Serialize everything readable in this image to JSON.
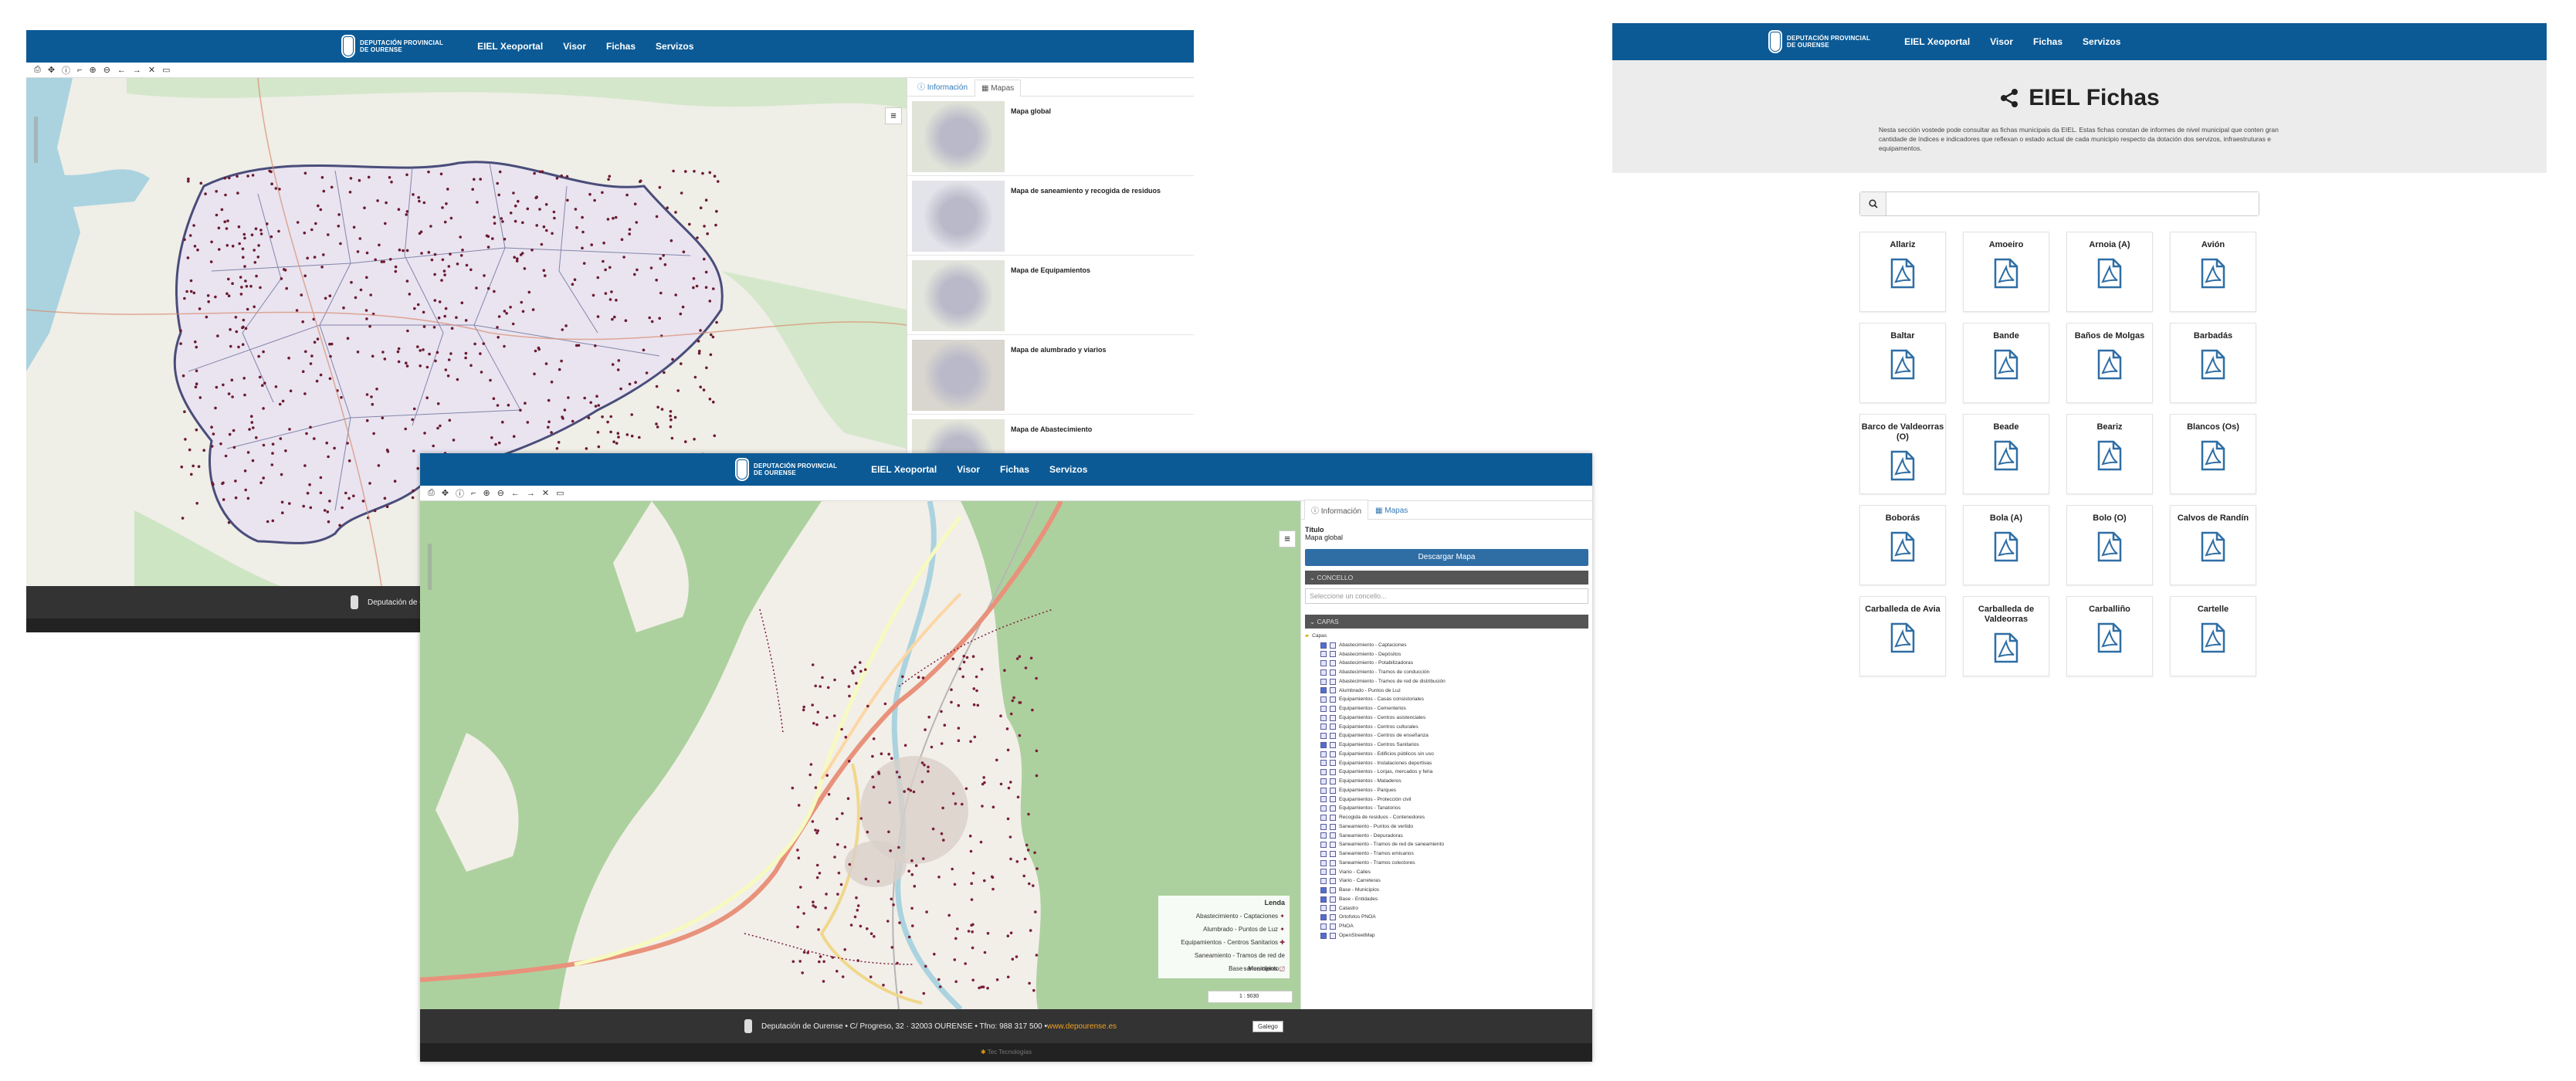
{
  "brand": {
    "logo_line1": "DEPUTACIÓN PROVINCIAL",
    "logo_line2": "DE OURENSE"
  },
  "nav": [
    "EIEL Xeoportal",
    "Visor",
    "Fichas",
    "Servizos"
  ],
  "visor_global": {
    "tabs": {
      "info": "Información",
      "maps": "Mapas"
    },
    "maps": [
      "Mapa global",
      "Mapa de saneamiento y recogida de residuos",
      "Mapa de Equipamientos",
      "Mapa de alumbrado y viarios",
      "Mapa de Abastecimiento"
    ],
    "footer_text": "Deputación de O"
  },
  "visor_detail": {
    "tabs": {
      "info": "Información",
      "maps": "Mapas"
    },
    "titulo_label": "Título",
    "titulo_value": "Mapa global",
    "download_label": "Descargar Mapa",
    "concello_label": "CONCELLO",
    "concello_placeholder": "Seleccione un concello...",
    "capas_label": "CAPAS",
    "root_layer": "Capas",
    "layers": [
      "Abastecimiento - Captaciones",
      "Abastecimiento - Depósitos",
      "Abastecimiento - Potabilizadoras",
      "Abastecimiento - Tramos de conducción",
      "Abastecimiento - Tramos de red de distribución",
      "Alumbrado - Puntos de Luz",
      "Equipamientos - Casas consistoriales",
      "Equipamientos - Cementerios",
      "Equipamientos - Centros asistenciales",
      "Equipamientos - Centros culturales",
      "Equipamientos - Centros de enseñanza",
      "Equipamientos - Centros Sanitarios",
      "Equipamientos - Edificios públicos sin uso",
      "Equipamientos - Instalaciones deportivas",
      "Equipamientos - Lonjas, mercados y feria",
      "Equipamientos - Mataderos",
      "Equipamientos - Parques",
      "Equipamientos - Protección civil",
      "Equipamientos - Tanatorios",
      "Recogida de residuos - Contenedores",
      "Saneamiento - Puntos de vertido",
      "Saneamiento - Depuradoras",
      "Saneamiento - Tramos de red de saneamiento",
      "Saneamiento - Tramos emisarios",
      "Saneamiento - Tramos colectores",
      "Viario - Calles",
      "Viario - Carreteras",
      "Base - Municipios",
      "Base - Entidades",
      "Catastro",
      "Ortofotos PNOA",
      "PNOA",
      "OpenStreetMap"
    ],
    "legend_title": "Lenda",
    "legend_items": [
      "Abastecimiento - Captaciones",
      "Alumbrado - Puntos de Luz",
      "Equipamientos - Centros Sanitarios",
      "Saneamiento - Tramos de red de saneamiento",
      "Base - Municipios"
    ],
    "scale": "1 : 9030",
    "footer_text": "Deputación de Ourense • C/ Progreso, 32 · 32003 OURENSE • Tfno: 988 317 500 • ",
    "footer_link": "www.depourense.es",
    "language": "Galego",
    "credit": "Tec Tecnologías"
  },
  "fichas": {
    "title": "EIEL Fichas",
    "description": "Nesta sección vostede pode consultar as fichas municipais da EIEL. Estas fichas constan de informes de nivel municipal que conten gran cantidade de índices e indicadores que reflexan o estado actual de cada municipio respecto da dotación dos servizos, infraestruturas e equipamentos.",
    "search_placeholder": "",
    "municipalities": [
      "Allariz",
      "Amoeiro",
      "Arnoia (A)",
      "Avión",
      "Baltar",
      "Bande",
      "Baños de Molgas",
      "Barbadás",
      "Barco de Valdeorras (O)",
      "Beade",
      "Beariz",
      "Blancos (Os)",
      "Boborás",
      "Bola (A)",
      "Bolo (O)",
      "Calvos de Randín",
      "Carballeda de Avia",
      "Carballeda de Valdeorras",
      "Carballiño",
      "Cartelle"
    ]
  }
}
